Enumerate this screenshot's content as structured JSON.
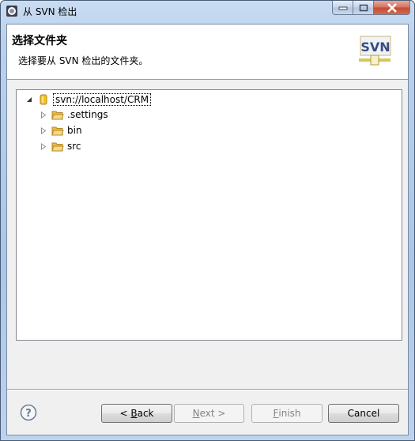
{
  "window": {
    "title": "从 SVN 检出",
    "controls": {
      "minimize": "minimize",
      "maximize": "maximize",
      "close": "close"
    }
  },
  "header": {
    "title": "选择文件夹",
    "description": "选择要从 SVN 检出的文件夹。",
    "logo_text": "SVN"
  },
  "tree": {
    "root": {
      "label": "svn://localhost/CRM",
      "expanded": true,
      "icon": "repository-icon"
    },
    "children": [
      {
        "label": ".settings",
        "expanded": false,
        "icon": "folder-icon"
      },
      {
        "label": "bin",
        "expanded": false,
        "icon": "folder-icon"
      },
      {
        "label": "src",
        "expanded": false,
        "icon": "folder-icon"
      }
    ]
  },
  "buttons": {
    "back": {
      "prefix": "< ",
      "mnemonic": "B",
      "rest": "ack",
      "enabled": true
    },
    "next": {
      "mnemonic": "N",
      "rest": "ext >",
      "enabled": false
    },
    "finish": {
      "mnemonic": "F",
      "rest": "inish",
      "enabled": false
    },
    "cancel": {
      "label": "Cancel",
      "enabled": true
    }
  },
  "colors": {
    "frame": "#aac6e8",
    "close_button": "#c24b33",
    "dialog_bg": "#f0f0f0",
    "folder": "#e8b84a"
  }
}
